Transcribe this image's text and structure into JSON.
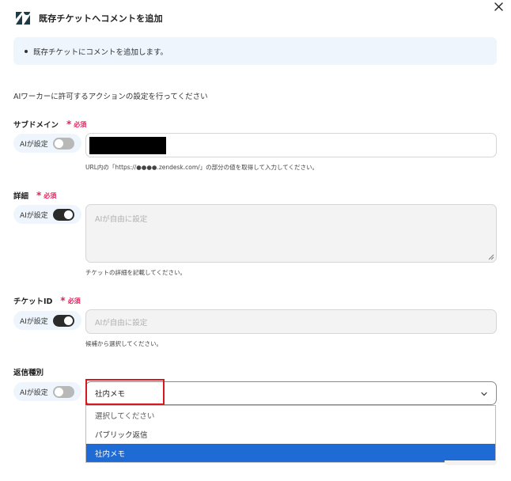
{
  "header": {
    "title": "既存チケットへコメントを追加"
  },
  "info": {
    "bullet_text": "既存チケットにコメントを追加します。"
  },
  "section_note": "AIワーカーに許可するアクションの設定を行ってください",
  "required_label": "必須",
  "ai_toggle_label": "AIが設定",
  "fields": {
    "subdomain": {
      "label": "サブドメイン",
      "required": true,
      "ai_enabled": false,
      "help": "URL内の「https://●●●●.zendesk.com/」の部分の値を取得して入力してください。"
    },
    "details": {
      "label": "詳細",
      "required": true,
      "ai_enabled": true,
      "placeholder": "AIが自由に設定",
      "help": "チケットの詳細を記載してください。"
    },
    "ticket_id": {
      "label": "チケットID",
      "required": true,
      "ai_enabled": true,
      "placeholder": "AIが自由に設定",
      "help": "候補から選択してください。"
    },
    "reply_type": {
      "label": "返信種別",
      "required": false,
      "ai_enabled": false,
      "selected": "社内メモ",
      "options": [
        "選択してください",
        "パブリック返信",
        "社内メモ"
      ]
    }
  },
  "colors": {
    "accent_blue": "#1f6bd6",
    "required_red": "#e0245e",
    "highlight_red": "#d7191f",
    "info_bg": "#eef5fd"
  }
}
